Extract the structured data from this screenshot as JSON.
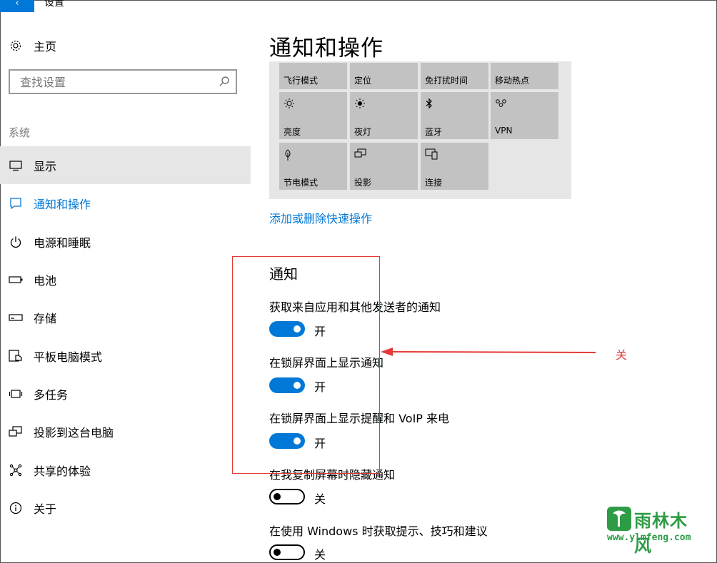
{
  "window": {
    "title": "设置",
    "back_glyph": "‹"
  },
  "sidebar": {
    "home_label": "主页",
    "search_placeholder": "查找设置",
    "section_label": "系统",
    "items": [
      {
        "label": "显示",
        "icon": "monitor-icon"
      },
      {
        "label": "通知和操作",
        "icon": "notification-icon"
      },
      {
        "label": "电源和睡眠",
        "icon": "power-icon"
      },
      {
        "label": "电池",
        "icon": "battery-icon"
      },
      {
        "label": "存储",
        "icon": "storage-icon"
      },
      {
        "label": "平板电脑模式",
        "icon": "tablet-mode-icon"
      },
      {
        "label": "多任务",
        "icon": "multitasking-icon"
      },
      {
        "label": "投影到这台电脑",
        "icon": "project-icon"
      },
      {
        "label": "共享的体验",
        "icon": "shared-experience-icon"
      },
      {
        "label": "关于",
        "icon": "info-icon"
      }
    ]
  },
  "main": {
    "title": "通知和操作",
    "quick_actions": [
      {
        "label": "飞行模式"
      },
      {
        "label": "定位"
      },
      {
        "label": "免打扰时间"
      },
      {
        "label": "移动热点"
      },
      {
        "label": "亮度",
        "icon": "brightness-icon"
      },
      {
        "label": "夜灯",
        "icon": "night-light-icon"
      },
      {
        "label": "蓝牙",
        "icon": "bluetooth-icon"
      },
      {
        "label": "VPN",
        "icon": "vpn-icon"
      },
      {
        "label": "节电模式",
        "icon": "battery-saver-icon"
      },
      {
        "label": "投影",
        "icon": "project-icon"
      },
      {
        "label": "连接",
        "icon": "connect-icon"
      }
    ],
    "add_remove_link": "添加或删除快速操作",
    "notifications_header": "通知",
    "settings": [
      {
        "label": "获取来自应用和其他发送者的通知",
        "state": "开",
        "on": true
      },
      {
        "label": "在锁屏界面上显示通知",
        "state": "开",
        "on": true
      },
      {
        "label": "在锁屏界面上显示提醒和 VoIP 来电",
        "state": "开",
        "on": true
      },
      {
        "label": "在我复制屏幕时隐藏通知",
        "state": "关",
        "on": false
      },
      {
        "label": "在使用 Windows 时获取提示、技巧和建议",
        "state": "关",
        "on": false
      }
    ]
  },
  "annotation": {
    "text": "关",
    "color": "#e53935"
  },
  "watermark": {
    "title": "雨林木风",
    "url": "www.ylmfeng.com"
  },
  "colors": {
    "accent": "#0078d7",
    "tile": "#c2c2c2",
    "panel": "#e6e6e6",
    "selected": "#e6e6e6"
  }
}
